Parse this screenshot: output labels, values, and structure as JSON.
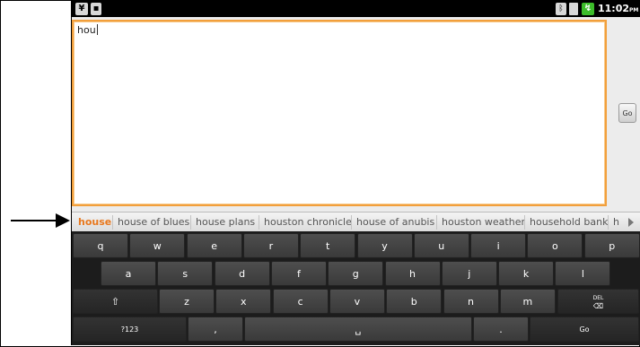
{
  "status_bar": {
    "usb_icon": "usb-debug-icon",
    "sd_icon": "sd-card-icon",
    "bluetooth_icon": "bluetooth-icon",
    "signal_icon": "signal-icon",
    "battery_icon": "battery-icon",
    "time": "11:02",
    "ampm": "PM"
  },
  "editor": {
    "value": "hou",
    "accent": "#f29f3b"
  },
  "go_side_button": "Go",
  "suggestions": [
    "house",
    "house of blues",
    "house plans",
    "houston chronicle",
    "house of anubis",
    "houston weather",
    "household bank",
    "h"
  ],
  "keyboard": {
    "row1": [
      "q",
      "w",
      "e",
      "r",
      "t",
      "y",
      "u",
      "i",
      "o",
      "p"
    ],
    "row2": [
      "a",
      "s",
      "d",
      "f",
      "g",
      "h",
      "j",
      "k",
      "l"
    ],
    "row3": [
      "z",
      "x",
      "c",
      "v",
      "b",
      "n",
      "m"
    ],
    "shift_icon": "shift-icon",
    "delete_label": "DEL",
    "sym_label": "?123",
    "comma_label": ",",
    "space_icon": "space-icon",
    "period_label": ".",
    "go_label": "Go"
  }
}
